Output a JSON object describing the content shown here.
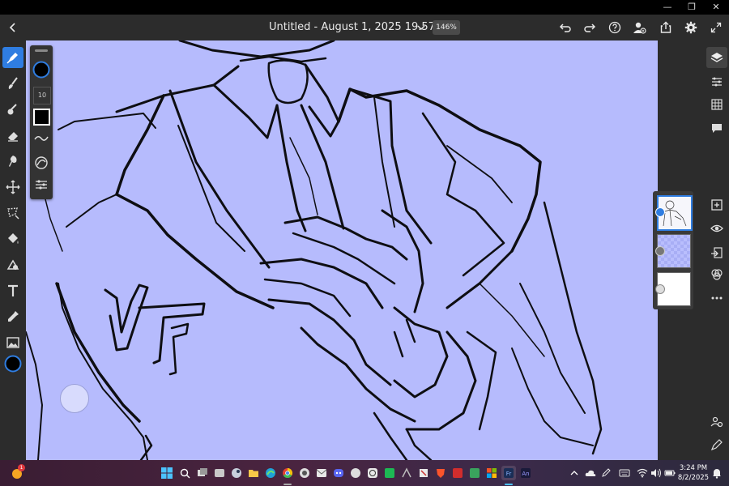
{
  "window": {
    "minimize": "—",
    "restore": "❐",
    "close": "✕"
  },
  "header": {
    "title": "Untitled - August 1, 2025 19.57.11*",
    "zoom": "146%",
    "icons": [
      "back-icon",
      "chevron-down-icon",
      "undo-icon",
      "redo-icon",
      "help-icon",
      "share-user-icon",
      "export-icon",
      "settings-icon",
      "fullscreen-icon"
    ]
  },
  "left_toolbar": {
    "tools": [
      "pixel-brush-icon",
      "paint-brush-icon",
      "fill-brush-icon",
      "eraser-icon",
      "smudge-icon",
      "transform-icon",
      "lasso-icon",
      "paint-bucket-icon",
      "shape-icon",
      "text-icon",
      "eyedropper-icon",
      "image-icon",
      "color-swatch-icon"
    ],
    "active": "pixel-brush-icon"
  },
  "brush_panel": {
    "size": "10",
    "color": "#000000"
  },
  "right_toolbar": {
    "tools": [
      "layers-icon",
      "adjustments-icon",
      "grid-icon",
      "comment-icon",
      "add-layer-icon",
      "visibility-icon",
      "import-icon",
      "blend-icon",
      "more-icon",
      "collab-icon",
      "pencil-icon"
    ]
  },
  "layers": [
    "sketch-layer",
    "color-layer",
    "background-layer"
  ],
  "taskbar": {
    "time": "3:24 PM",
    "date": "8/2/2025",
    "weather_badge": "1"
  },
  "colors": {
    "canvas": "#b6bbfd",
    "accent": "#2f7de1",
    "chrome": "#2c2c2c"
  }
}
